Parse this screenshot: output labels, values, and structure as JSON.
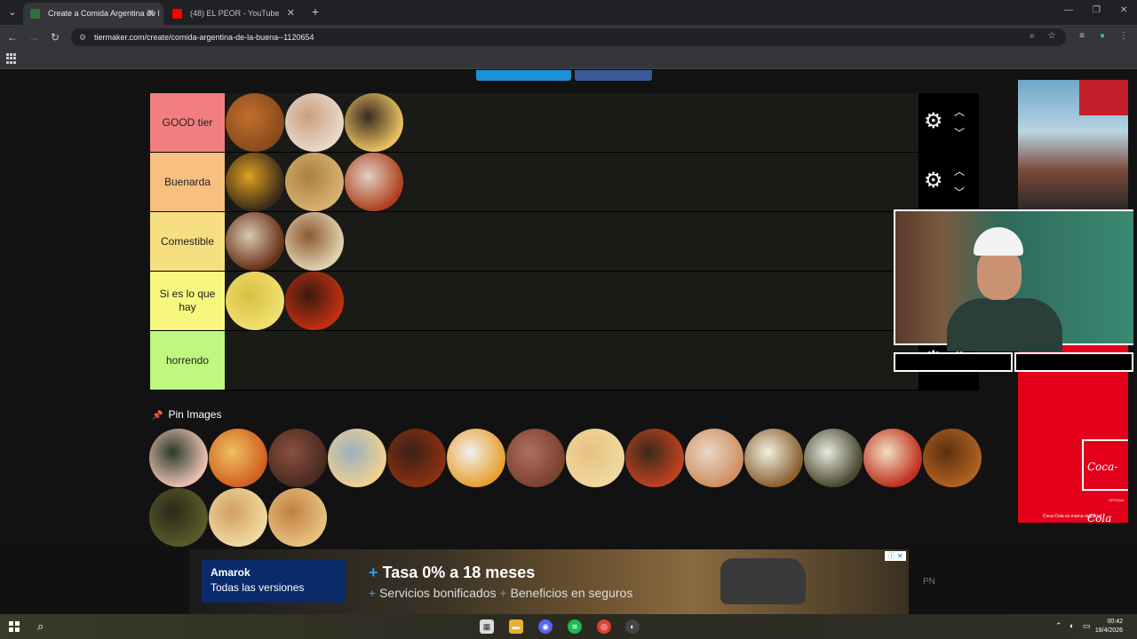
{
  "browser": {
    "tabs": [
      {
        "title": "Create a Comida Argentina de l",
        "active": true,
        "favicon_color": "#2f6f3a"
      },
      {
        "title": "(48) EL PEOR - YouTube",
        "active": false,
        "favicon_color": "#ff0000"
      }
    ],
    "close_glyph": "✕",
    "new_tab_glyph": "+",
    "url": "tiermaker.com/create/comida-argentina-de-la-buena--1120654"
  },
  "tierlist": {
    "tiers": [
      {
        "label": "GOOD tier",
        "color": "#f27f7f",
        "items": [
          {
            "name": "locro",
            "colors": [
              "#8a4a1a",
              "#c07030"
            ]
          },
          {
            "name": "sandwich-de-miga",
            "colors": [
              "#e8d8c8",
              "#c8a080"
            ]
          },
          {
            "name": "pastafrola",
            "colors": [
              "#e8c060",
              "#3a2a20"
            ]
          }
        ]
      },
      {
        "label": "Buenarda",
        "color": "#f7bf80",
        "items": [
          {
            "name": "hamburguesa",
            "colors": [
              "#3a2a1a",
              "#e0a020"
            ]
          },
          {
            "name": "empanadas",
            "colors": [
              "#d8b070",
              "#a88040"
            ]
          },
          {
            "name": "fideos-con-tuco",
            "colors": [
              "#b04020",
              "#e0d0c0"
            ]
          }
        ]
      },
      {
        "label": "Comestible",
        "color": "#f7de80",
        "items": [
          {
            "name": "albondigas",
            "colors": [
              "#6a3018",
              "#d8c8b0"
            ]
          },
          {
            "name": "canelones",
            "colors": [
              "#e0d0b0",
              "#8a5a30"
            ]
          }
        ]
      },
      {
        "label": "Si es lo que hay",
        "color": "#f7f780",
        "items": [
          {
            "name": "fideos-con-manteca",
            "colors": [
              "#f0e070",
              "#d8c040"
            ]
          },
          {
            "name": "fideos-con-salsa",
            "colors": [
              "#c03010",
              "#3a1a10"
            ]
          }
        ]
      },
      {
        "label": "horrendo",
        "color": "#bff780",
        "items": []
      }
    ]
  },
  "pool": {
    "pin_label": "Pin Images",
    "items": [
      {
        "name": "sushi",
        "colors": [
          "#e8c0b0",
          "#2a3a2a"
        ]
      },
      {
        "name": "lasagna",
        "colors": [
          "#d06020",
          "#f0c060"
        ]
      },
      {
        "name": "asado",
        "colors": [
          "#4a2a20",
          "#8a5040"
        ]
      },
      {
        "name": "chipa-sandwich",
        "colors": [
          "#f0d090",
          "#9ab0c0"
        ]
      },
      {
        "name": "guiso",
        "colors": [
          "#8a3010",
          "#3a2018"
        ]
      },
      {
        "name": "nuggets",
        "colors": [
          "#e8a030",
          "#f0f0f0"
        ]
      },
      {
        "name": "bife",
        "colors": [
          "#7a4030",
          "#b07060"
        ]
      },
      {
        "name": "pizza-muzzarella",
        "colors": [
          "#f0d8a0",
          "#e8c080"
        ]
      },
      {
        "name": "pizza-pepperoni",
        "colors": [
          "#c04020",
          "#3a2a1a"
        ]
      },
      {
        "name": "pancho",
        "colors": [
          "#d09060",
          "#e8d8c8"
        ]
      },
      {
        "name": "milanesa-con-pure",
        "colors": [
          "#8a6030",
          "#f0f0e0"
        ]
      },
      {
        "name": "ensalada",
        "colors": [
          "#4a4a30",
          "#e8e8e0"
        ]
      },
      {
        "name": "ñoquis",
        "colors": [
          "#c03020",
          "#f0e0c0"
        ]
      },
      {
        "name": "pollo",
        "colors": [
          "#b06020",
          "#5a3010"
        ]
      },
      {
        "name": "estofado",
        "colors": [
          "#5a5a2a",
          "#2a2a1a"
        ]
      },
      {
        "name": "empanada-frita",
        "colors": [
          "#f0d8a0",
          "#d0a060"
        ]
      },
      {
        "name": "rabas",
        "colors": [
          "#e8c080",
          "#c08040"
        ]
      }
    ]
  },
  "ads": {
    "banner": {
      "model": "Amarok",
      "subtitle": "Todas las versiones",
      "headline_plus": "+",
      "headline": "Tasa 0% a 18 meses",
      "line2_a": "Servicios bonificados",
      "line2_b": "Beneficios en seguros",
      "info": "ⓘ ✕",
      "pn": "PN"
    },
    "side": {
      "brand": "Coca-Cola",
      "official": "OFFICIAL",
      "footer": "Coca-Cola es marca registrad"
    }
  },
  "taskbar": {
    "time": "00:42",
    "date": "18/4/2026"
  },
  "colors": {
    "share_twitter": "#1d8fd8",
    "share_facebook": "#3b5998"
  }
}
